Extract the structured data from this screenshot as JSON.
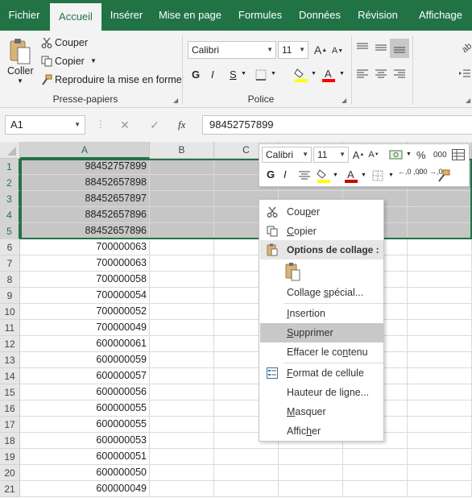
{
  "tabs": [
    {
      "label": "Fichier",
      "active": false
    },
    {
      "label": "Accueil",
      "active": true
    },
    {
      "label": "Insérer",
      "active": false
    },
    {
      "label": "Mise en page",
      "active": false
    },
    {
      "label": "Formules",
      "active": false
    },
    {
      "label": "Données",
      "active": false
    },
    {
      "label": "Révision",
      "active": false
    },
    {
      "label": "Affichage",
      "active": false
    }
  ],
  "clipboard": {
    "paste_label": "Coller",
    "cut_label": "Couper",
    "copy_label": "Copier",
    "format_painter_label": "Reproduire la mise en forme",
    "group_label": "Presse-papiers"
  },
  "font": {
    "font_name": "Calibri",
    "font_size": "11",
    "bold": "G",
    "italic": "I",
    "underline": "S",
    "group_label": "Police",
    "grow": "A",
    "shrink": "A"
  },
  "colors": {
    "brand": "#217346",
    "highlight": "#ffff00",
    "font_color": "#ff0000"
  },
  "formula_bar": {
    "name_box": "A1",
    "fx": "fx",
    "value": "98452757899"
  },
  "grid": {
    "columns": [
      "A",
      "B",
      "C"
    ],
    "rows": [
      {
        "n": "1",
        "a": "98452757899",
        "selected": true
      },
      {
        "n": "2",
        "a": "88452657898",
        "selected": true
      },
      {
        "n": "3",
        "a": "88452657897",
        "selected": true
      },
      {
        "n": "4",
        "a": "88452657896",
        "selected": true
      },
      {
        "n": "5",
        "a": "88452657896",
        "selected": true
      },
      {
        "n": "6",
        "a": "700000063",
        "selected": false
      },
      {
        "n": "7",
        "a": "700000063",
        "selected": false
      },
      {
        "n": "8",
        "a": "700000058",
        "selected": false
      },
      {
        "n": "9",
        "a": "700000054",
        "selected": false
      },
      {
        "n": "10",
        "a": "700000052",
        "selected": false
      },
      {
        "n": "11",
        "a": "700000049",
        "selected": false
      },
      {
        "n": "12",
        "a": "600000061",
        "selected": false
      },
      {
        "n": "13",
        "a": "600000059",
        "selected": false
      },
      {
        "n": "14",
        "a": "600000057",
        "selected": false
      },
      {
        "n": "15",
        "a": "600000056",
        "selected": false
      },
      {
        "n": "16",
        "a": "600000055",
        "selected": false
      },
      {
        "n": "17",
        "a": "600000055",
        "selected": false
      },
      {
        "n": "18",
        "a": "600000053",
        "selected": false
      },
      {
        "n": "19",
        "a": "600000051",
        "selected": false
      },
      {
        "n": "20",
        "a": "600000050",
        "selected": false
      },
      {
        "n": "21",
        "a": "600000049",
        "selected": false
      }
    ]
  },
  "mini_toolbar": {
    "font_name": "Calibri",
    "font_size": "11",
    "percent": "%",
    "thousands": "000",
    "bold": "G",
    "italic": "I",
    "increase_decimal": "←,0 ,00",
    "decrease_decimal": ",00 →,0"
  },
  "context_menu": {
    "cut": {
      "pre": "Cou",
      "ul": "p",
      "post": "er"
    },
    "copy": {
      "pre": "",
      "ul": "C",
      "post": "opier"
    },
    "paste_options_header": "Options de collage :",
    "paste_special": {
      "pre": "Collage ",
      "ul": "s",
      "post": "pécial..."
    },
    "insert": {
      "pre": "",
      "ul": "I",
      "post": "nsertion"
    },
    "delete": {
      "pre": "",
      "ul": "S",
      "post": "upprimer"
    },
    "clear": {
      "pre": "Effacer le co",
      "ul": "n",
      "post": "tenu"
    },
    "format_cells": {
      "pre": "",
      "ul": "F",
      "post": "ormat de cellule"
    },
    "row_height": {
      "pre": "Hauteur de li",
      "ul": "g",
      "post": "ne..."
    },
    "hide": {
      "pre": "",
      "ul": "M",
      "post": "asquer"
    },
    "unhide": {
      "pre": "Affic",
      "ul": "h",
      "post": "er"
    }
  }
}
